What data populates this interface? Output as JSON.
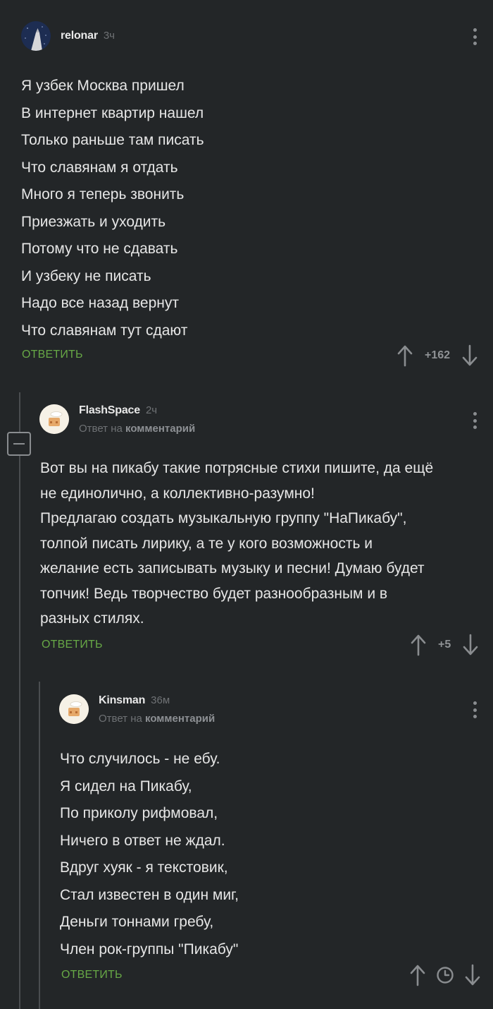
{
  "comments": [
    {
      "username": "relonar",
      "time": "3ч",
      "lines": [
        "Я узбек Москва пришел",
        "В интернет квартир нашел",
        "Только раньше там писать",
        "Что славянам я отдать",
        "Много я теперь звонить",
        "Приезжать и уходить",
        "Потому что не сдавать",
        "И узбеку не писать",
        "Надо все назад вернут",
        "Что славянам тут сдают"
      ],
      "reply_label": "ОТВЕТИТЬ",
      "votes": "+162"
    },
    {
      "username": "FlashSpace",
      "time": "2ч",
      "reply_to_prefix": "Ответ на",
      "reply_to_target": "комментарий",
      "lines": [
        "Вот вы на пикабу такие потрясные стихи пишите, да ещё",
        "не единолично, а коллективно-разумно!",
        "Предлагаю создать музыкальную группу \"НаПикабу\",",
        "толпой писать лирику, а те у кого возможность и",
        "желание есть записывать музыку и песни! Думаю будет",
        "топчик! Ведь творчество будет разнообразным и в",
        "разных стилях."
      ],
      "reply_label": "ОТВЕТИТЬ",
      "votes": "+5"
    },
    {
      "username": "Kinsman",
      "time": "36м",
      "reply_to_prefix": "Ответ на",
      "reply_to_target": "комментарий",
      "lines": [
        "Что случилось - не ебу.",
        "Я сидел на Пикабу,",
        "По приколу рифмовал,",
        "Ничего в ответ не ждал.",
        "Вдруг хуяк - я текстовик,",
        "Стал известен в один миг,",
        "Деньги тоннами гребу,",
        "Член рок-группы \"Пикабу\""
      ],
      "reply_label": "ОТВЕТИТЬ"
    }
  ],
  "icons": {
    "upvote": "arrow-up-icon",
    "downvote": "arrow-down-icon",
    "pending": "clock-icon",
    "menu": "kebab-menu-icon",
    "collapse": "collapse-minus-icon"
  },
  "colors": {
    "background": "#232628",
    "accent_green": "#67a846",
    "muted": "#6f7275",
    "thread_line": "#4a4d50"
  }
}
